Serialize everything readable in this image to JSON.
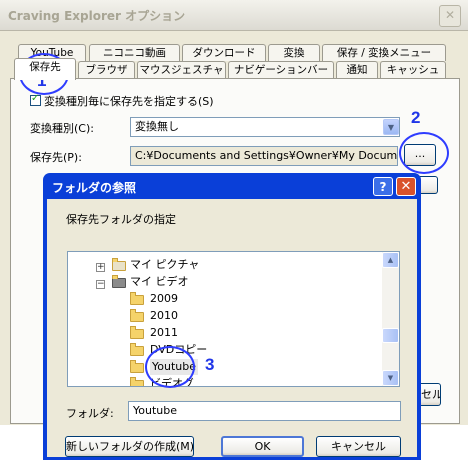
{
  "outer": {
    "title": "Craving Explorer オプション",
    "close_glyph": "✕",
    "tabs_row1": [
      "YouTube",
      "ニコニコ動画",
      "ダウンロード",
      "変換",
      "保存 / 変換メニュー"
    ],
    "tabs_row2": [
      "保存先",
      "ブラウザ",
      "マウスジェスチャ",
      "ナビゲーションバー",
      "通知",
      "キャッシュ"
    ],
    "checkbox_label": "変換種別毎に保存先を指定する(S)",
    "checkbox_checked": true,
    "convert_type_label": "変換種別(C):",
    "convert_type_value": "変換無し",
    "save_dest_label": "保存先(P):",
    "save_dest_value": "C:¥Documents and Settings¥Owner¥My Documents¥M",
    "browse_button": "...",
    "partial_button": "セル"
  },
  "annotations": [
    "1",
    "2",
    "3"
  ],
  "dialog": {
    "title": "フォルダの参照",
    "help_glyph": "?",
    "close_glyph": "✕",
    "instruction": "保存先フォルダの指定",
    "tree": [
      {
        "label": "マイ ピクチャ",
        "expander": "+"
      },
      {
        "label": "マイ ビデオ",
        "expander": "−"
      },
      {
        "label": "2009"
      },
      {
        "label": "2010"
      },
      {
        "label": "2011"
      },
      {
        "label": "DVDコピー"
      },
      {
        "label": "Youtube",
        "selected": true
      },
      {
        "label": "ビデオグ"
      }
    ],
    "folder_label": "フォルダ:",
    "folder_value": "Youtube",
    "new_folder_button": "新しいフォルダの作成(M)",
    "ok_button": "OK",
    "cancel_button": "キャンセル"
  },
  "colors": {
    "accent": "#0a3fd8",
    "annotation": "#2036e8",
    "checkmark": "#21a121"
  }
}
